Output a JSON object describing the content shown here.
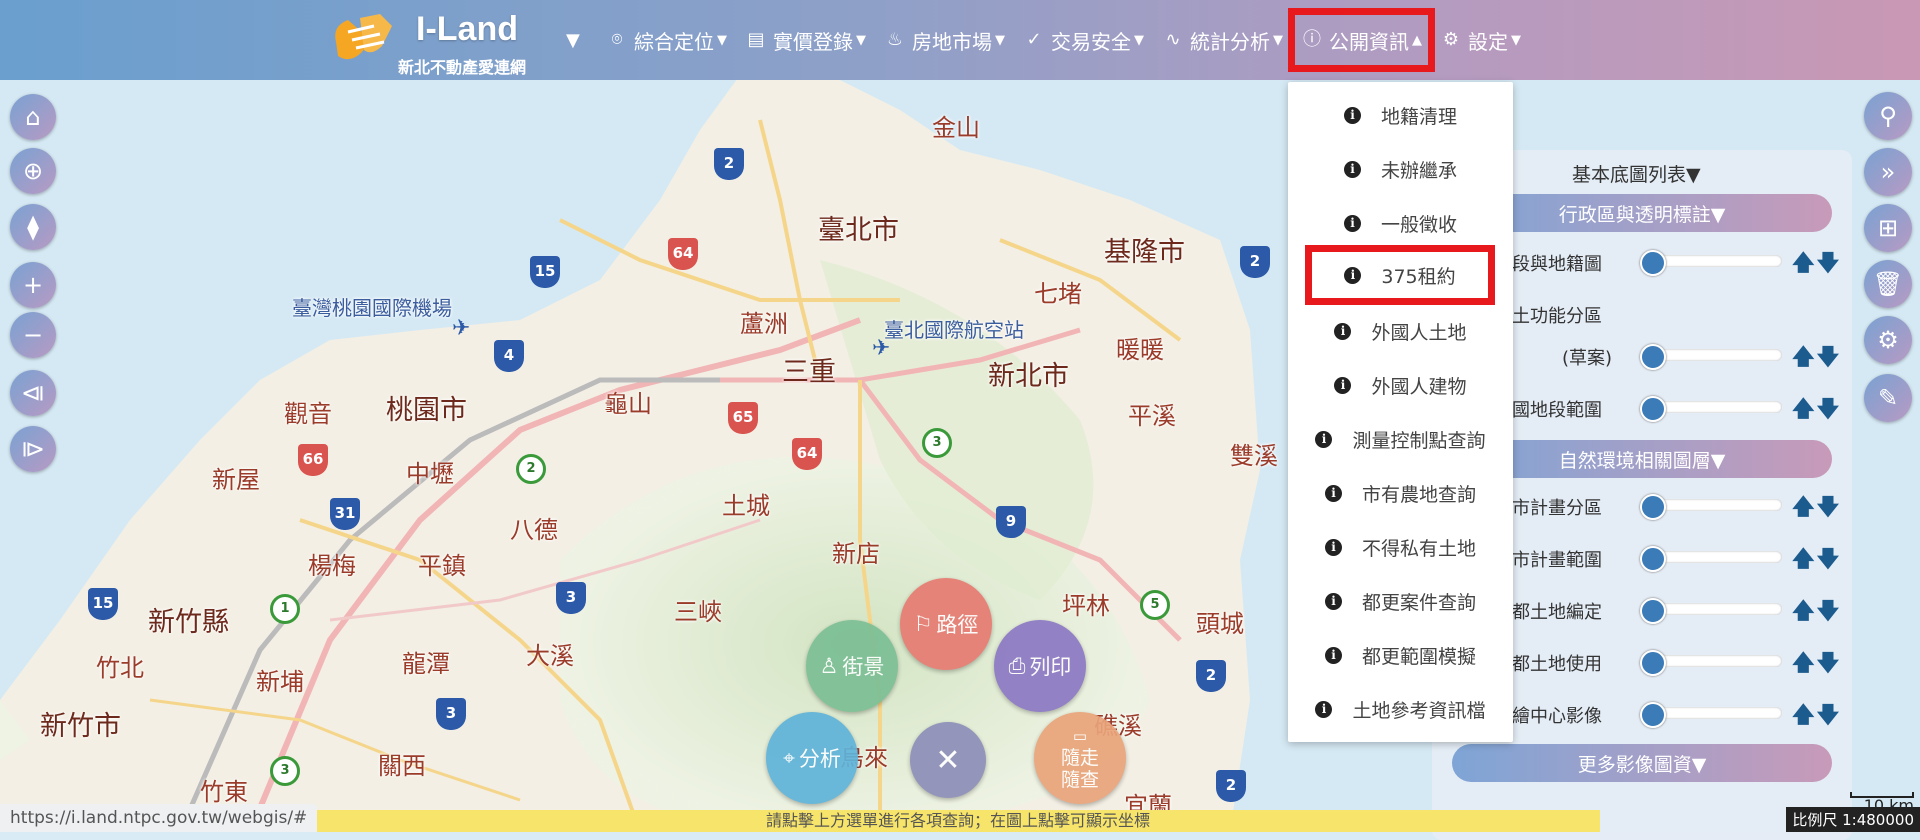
{
  "app": {
    "title": "I-Land",
    "subtitle": "新北不動產愛連網"
  },
  "nav": {
    "items": [
      {
        "label": "綜合定位",
        "icon": "map-pin-icon"
      },
      {
        "label": "實價登錄",
        "icon": "document-icon"
      },
      {
        "label": "房地市場",
        "icon": "flame-icon"
      },
      {
        "label": "交易安全",
        "icon": "check-circle-icon"
      },
      {
        "label": "統計分析",
        "icon": "pulse-icon"
      },
      {
        "label": "公開資訊",
        "icon": "info-circle-icon",
        "active": true
      },
      {
        "label": "設定",
        "icon": "gear-icon"
      }
    ]
  },
  "dropdown": {
    "items": [
      "地籍清理",
      "未辦繼承",
      "一般徵收",
      "375租約",
      "外國人土地",
      "外國人建物",
      "測量控制點查詢",
      "市有農地查詢",
      "不得私有土地",
      "都更案件查詢",
      "都更範圍模擬",
      "土地參考資訊檔"
    ],
    "highlighted": "375租約"
  },
  "layer_panel": {
    "title": "基本底圖列表▼",
    "groups": [
      {
        "label": "行政區與透明標註▼"
      },
      {
        "label": "自然環境相關圖層▼"
      },
      {
        "label": "更多影像圖資▼"
      }
    ],
    "rows": [
      {
        "label": "地段與地籍圖"
      },
      {
        "label": "國土功能分區"
      },
      {
        "label": "(草案)"
      },
      {
        "label": "全國地段範圍"
      },
      {
        "label": "都市計畫分區"
      },
      {
        "label": "都市計畫範圍"
      },
      {
        "label": "非都土地編定"
      },
      {
        "label": "非都土地使用"
      },
      {
        "label": "測繪中心影像"
      }
    ],
    "arrows": "🡅🡇"
  },
  "fab": {
    "route": "路徑",
    "streetview": "街景",
    "print": "列印",
    "analysis": "分析",
    "close": "✕",
    "walk1": "隨走",
    "walk2": "隨查"
  },
  "map": {
    "places": [
      "臺北市",
      "基隆市",
      "新北市",
      "七堵",
      "暖暖",
      "平溪",
      "雙溪",
      "蘆洲",
      "三重",
      "龜山",
      "桃園市",
      "觀音",
      "新屋",
      "中壢",
      "八德",
      "楊梅",
      "平鎮",
      "新竹縣",
      "竹北",
      "新竹市",
      "新埔",
      "龍潭",
      "大溪",
      "三峽",
      "土城",
      "新店",
      "坪林",
      "頭城",
      "關西",
      "竹東",
      "礁溪",
      "宜蘭",
      "金山",
      "烏來"
    ],
    "airports": [
      "臺灣桃園國際機場",
      "臺北國際航空站"
    ]
  },
  "status": {
    "url": "https://i.land.ntpc.gov.tw/webgis/#",
    "hint": "請點擊上方選單進行各項查詢；在圖上點擊可顯示坐標",
    "scale_km": "10 km",
    "scale_ratio": "比例尺 1:480000"
  },
  "colors": {
    "highlight": "#e8191c",
    "nav_start": "#6a9fce",
    "nav_end": "#c998b4"
  }
}
